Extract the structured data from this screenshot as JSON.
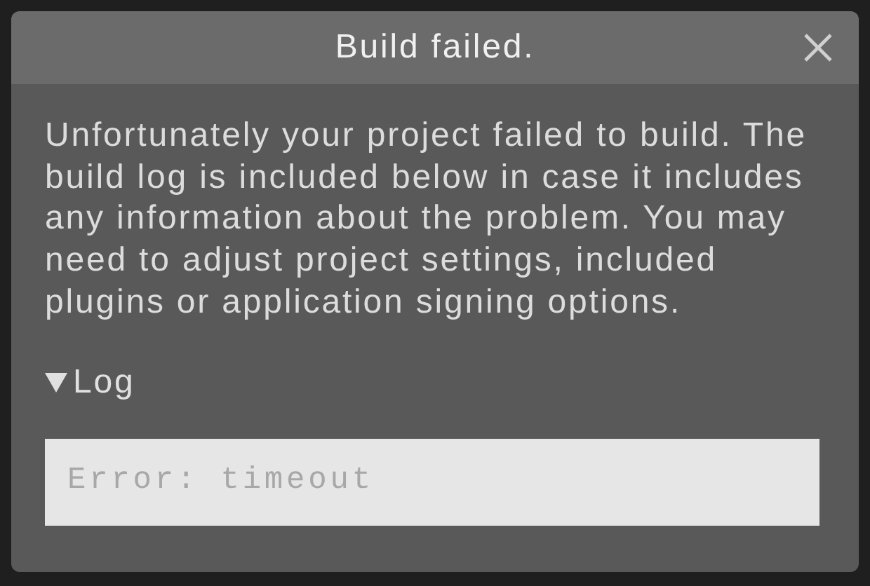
{
  "dialog": {
    "title": "Build failed.",
    "message": "Unfortunately your project failed to build. The build log is included below in case it includes any information about the problem. You may need to adjust project settings, included plugins or application signing options.",
    "log": {
      "label": "Log",
      "expanded": true,
      "content": "Error: timeout"
    }
  }
}
